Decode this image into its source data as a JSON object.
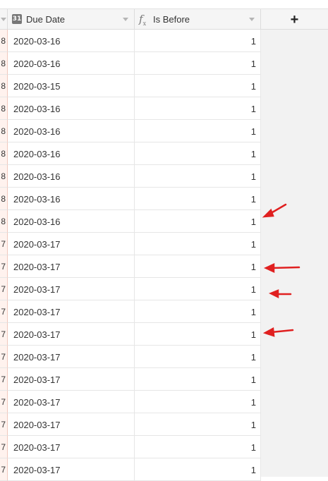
{
  "header": {
    "prev_column_partial": "",
    "due_date": {
      "label": "Due Date",
      "icon": "calendar-icon",
      "icon_glyph": "31"
    },
    "is_before": {
      "label": "Is Before",
      "icon": "formula-icon"
    },
    "add_field": {
      "label": "+"
    }
  },
  "rows": [
    {
      "prev": "8",
      "due_date": "2020-03-16",
      "is_before": "1"
    },
    {
      "prev": "8",
      "due_date": "2020-03-16",
      "is_before": "1"
    },
    {
      "prev": "8",
      "due_date": "2020-03-15",
      "is_before": "1"
    },
    {
      "prev": "8",
      "due_date": "2020-03-16",
      "is_before": "1"
    },
    {
      "prev": "8",
      "due_date": "2020-03-16",
      "is_before": "1"
    },
    {
      "prev": "8",
      "due_date": "2020-03-16",
      "is_before": "1"
    },
    {
      "prev": "8",
      "due_date": "2020-03-16",
      "is_before": "1"
    },
    {
      "prev": "8",
      "due_date": "2020-03-16",
      "is_before": "1"
    },
    {
      "prev": "8",
      "due_date": "2020-03-16",
      "is_before": "1"
    },
    {
      "prev": "7",
      "due_date": "2020-03-17",
      "is_before": "1"
    },
    {
      "prev": "7",
      "due_date": "2020-03-17",
      "is_before": "1"
    },
    {
      "prev": "7",
      "due_date": "2020-03-17",
      "is_before": "1"
    },
    {
      "prev": "7",
      "due_date": "2020-03-17",
      "is_before": "1"
    },
    {
      "prev": "7",
      "due_date": "2020-03-17",
      "is_before": "1"
    },
    {
      "prev": "7",
      "due_date": "2020-03-17",
      "is_before": "1"
    },
    {
      "prev": "7",
      "due_date": "2020-03-17",
      "is_before": "1"
    },
    {
      "prev": "7",
      "due_date": "2020-03-17",
      "is_before": "1"
    },
    {
      "prev": "7",
      "due_date": "2020-03-17",
      "is_before": "1"
    },
    {
      "prev": "7",
      "due_date": "2020-03-17",
      "is_before": "1"
    },
    {
      "prev": "7",
      "due_date": "2020-03-17",
      "is_before": "1"
    }
  ],
  "colors": {
    "annotation_arrow": "#e02020",
    "header_bg": "#f5f5f5",
    "gutter_bg": "#f2f2f2",
    "prev_column_bg": "#fff2ee"
  }
}
